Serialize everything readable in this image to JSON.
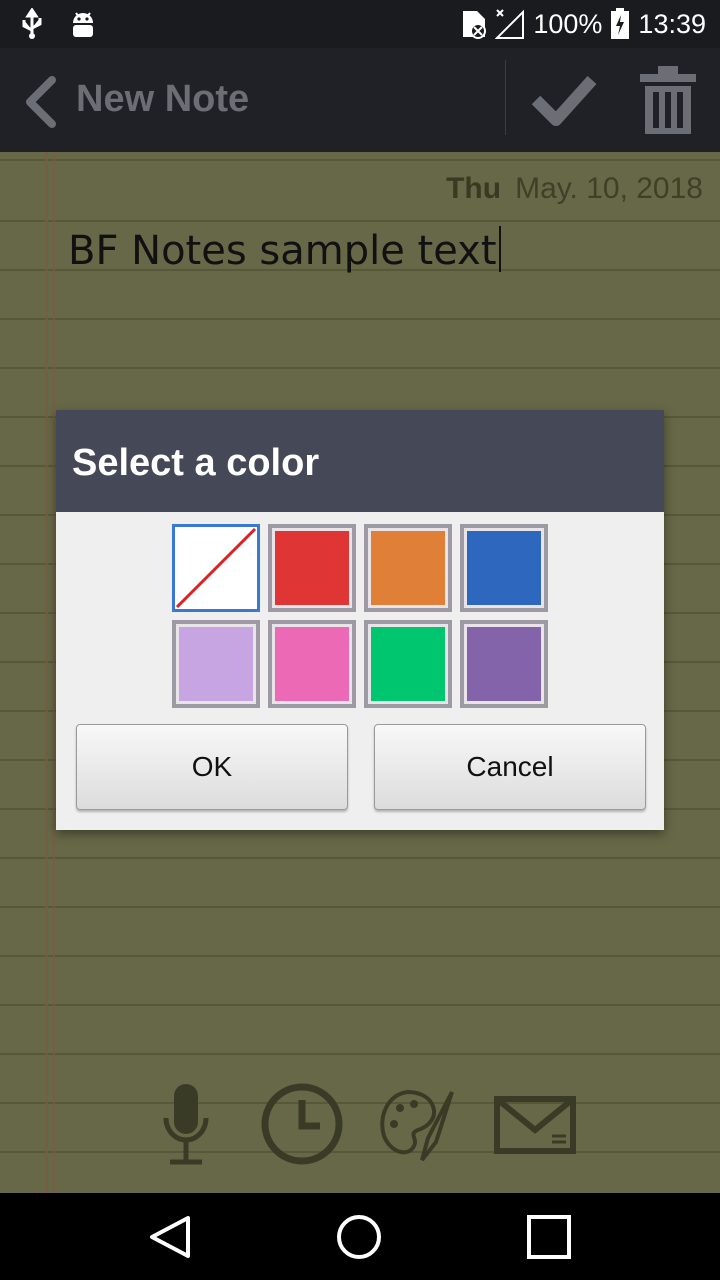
{
  "status": {
    "battery": "100%",
    "time": "13:39"
  },
  "appbar": {
    "title": "New Note"
  },
  "note": {
    "day": "Thu",
    "date": "May. 10, 2018",
    "text": "BF Notes sample text"
  },
  "dialog": {
    "title": "Select a color",
    "swatches": [
      {
        "name": "none",
        "color": "#ffffff",
        "selected": true
      },
      {
        "name": "red",
        "color": "#e03535"
      },
      {
        "name": "orange",
        "color": "#e07f38"
      },
      {
        "name": "blue",
        "color": "#2d67be"
      },
      {
        "name": "lavender",
        "color": "#c7a5e2"
      },
      {
        "name": "pink",
        "color": "#ec6ab5"
      },
      {
        "name": "green",
        "color": "#00c66f"
      },
      {
        "name": "purple",
        "color": "#8364ab"
      }
    ],
    "ok_label": "OK",
    "cancel_label": "Cancel"
  },
  "toolbar_icons": [
    "microphone-icon",
    "clock-icon",
    "palette-icon",
    "envelope-icon"
  ],
  "colors": {
    "paper": "#676847",
    "header": "#454856",
    "appbar": "#1f2127"
  }
}
